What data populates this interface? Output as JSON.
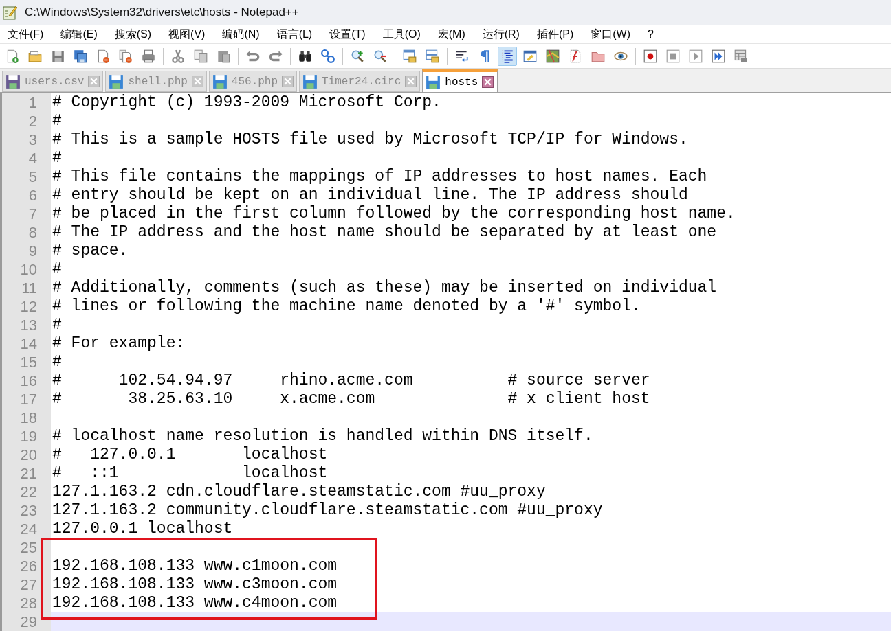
{
  "window": {
    "title": "C:\\Windows\\System32\\drivers\\etc\\hosts - Notepad++"
  },
  "menu": [
    {
      "label": "文件(F)"
    },
    {
      "label": "编辑(E)"
    },
    {
      "label": "搜索(S)"
    },
    {
      "label": "视图(V)"
    },
    {
      "label": "编码(N)"
    },
    {
      "label": "语言(L)"
    },
    {
      "label": "设置(T)"
    },
    {
      "label": "工具(O)"
    },
    {
      "label": "宏(M)"
    },
    {
      "label": "运行(R)"
    },
    {
      "label": "插件(P)"
    },
    {
      "label": "窗口(W)"
    },
    {
      "label": "?"
    }
  ],
  "toolbar": [
    {
      "kind": "new",
      "pressed": false
    },
    {
      "kind": "open",
      "pressed": false
    },
    {
      "kind": "save",
      "pressed": false
    },
    {
      "kind": "save-all",
      "pressed": false
    },
    {
      "kind": "close",
      "pressed": false
    },
    {
      "kind": "close-all",
      "pressed": false
    },
    {
      "kind": "print",
      "pressed": false
    },
    {
      "kind": "separator"
    },
    {
      "kind": "cut",
      "pressed": false
    },
    {
      "kind": "copy",
      "pressed": false
    },
    {
      "kind": "paste",
      "pressed": false
    },
    {
      "kind": "separator"
    },
    {
      "kind": "undo",
      "pressed": false
    },
    {
      "kind": "redo",
      "pressed": false
    },
    {
      "kind": "separator"
    },
    {
      "kind": "find",
      "pressed": false
    },
    {
      "kind": "replace",
      "pressed": false
    },
    {
      "kind": "separator"
    },
    {
      "kind": "zoom-in",
      "pressed": false
    },
    {
      "kind": "zoom-out",
      "pressed": false
    },
    {
      "kind": "separator"
    },
    {
      "kind": "sync-v",
      "pressed": false
    },
    {
      "kind": "sync-h",
      "pressed": false
    },
    {
      "kind": "separator"
    },
    {
      "kind": "wrap",
      "pressed": false
    },
    {
      "kind": "pilcrow",
      "pressed": false
    },
    {
      "kind": "indent-guide",
      "pressed": true
    },
    {
      "kind": "udl",
      "pressed": false
    },
    {
      "kind": "doc-map",
      "pressed": false
    },
    {
      "kind": "function-list",
      "pressed": false
    },
    {
      "kind": "folder",
      "pressed": false
    },
    {
      "kind": "monitor",
      "pressed": false
    },
    {
      "kind": "separator"
    },
    {
      "kind": "record",
      "pressed": false
    },
    {
      "kind": "stop",
      "pressed": false
    },
    {
      "kind": "play",
      "pressed": false
    },
    {
      "kind": "play-multi",
      "pressed": false
    },
    {
      "kind": "save-macro",
      "pressed": false
    }
  ],
  "tabs": [
    {
      "label": "users.csv",
      "selected": false
    },
    {
      "label": "shell.php",
      "selected": false
    },
    {
      "label": "456.php",
      "selected": false
    },
    {
      "label": "Timer24.circ",
      "selected": false
    },
    {
      "label": "hosts",
      "selected": true
    }
  ],
  "editor": {
    "lines": [
      {
        "number": "1",
        "text": "# Copyright (c) 1993-2009 Microsoft Corp.",
        "highlighted": false,
        "current": false
      },
      {
        "number": "2",
        "text": "#",
        "highlighted": false,
        "current": false
      },
      {
        "number": "3",
        "text": "# This is a sample HOSTS file used by Microsoft TCP/IP for Windows.",
        "highlighted": false,
        "current": false
      },
      {
        "number": "4",
        "text": "#",
        "highlighted": false,
        "current": false
      },
      {
        "number": "5",
        "text": "# This file contains the mappings of IP addresses to host names. Each",
        "highlighted": false,
        "current": false
      },
      {
        "number": "6",
        "text": "# entry should be kept on an individual line. The IP address should",
        "highlighted": false,
        "current": false
      },
      {
        "number": "7",
        "text": "# be placed in the first column followed by the corresponding host name.",
        "highlighted": false,
        "current": false
      },
      {
        "number": "8",
        "text": "# The IP address and the host name should be separated by at least one",
        "highlighted": false,
        "current": false
      },
      {
        "number": "9",
        "text": "# space.",
        "highlighted": false,
        "current": false
      },
      {
        "number": "10",
        "text": "#",
        "highlighted": false,
        "current": false
      },
      {
        "number": "11",
        "text": "# Additionally, comments (such as these) may be inserted on individual",
        "highlighted": false,
        "current": false
      },
      {
        "number": "12",
        "text": "# lines or following the machine name denoted by a '#' symbol.",
        "highlighted": false,
        "current": false
      },
      {
        "number": "13",
        "text": "#",
        "highlighted": false,
        "current": false
      },
      {
        "number": "14",
        "text": "# For example:",
        "highlighted": false,
        "current": false
      },
      {
        "number": "15",
        "text": "#",
        "highlighted": false,
        "current": false
      },
      {
        "number": "16",
        "text": "#      102.54.94.97     rhino.acme.com          # source server",
        "highlighted": false,
        "current": false
      },
      {
        "number": "17",
        "text": "#       38.25.63.10     x.acme.com              # x client host",
        "highlighted": false,
        "current": false
      },
      {
        "number": "18",
        "highlighted": false,
        "current": false
      },
      {
        "number": "19",
        "text": "# localhost name resolution is handled within DNS itself.",
        "highlighted": false,
        "current": false
      },
      {
        "number": "20",
        "text": "#   127.0.0.1       localhost",
        "highlighted": false,
        "current": false
      },
      {
        "number": "21",
        "text": "#   ::1             localhost",
        "highlighted": false,
        "current": false
      },
      {
        "number": "22",
        "text": "127.1.163.2 cdn.cloudflare.steamstatic.com #uu_proxy",
        "highlighted": false,
        "current": false
      },
      {
        "number": "23",
        "text": "127.1.163.2 community.cloudflare.steamstatic.com #uu_proxy",
        "highlighted": false,
        "current": false
      },
      {
        "number": "24",
        "text": "127.0.0.1 localhost",
        "highlighted": false,
        "current": false
      },
      {
        "number": "25",
        "highlighted": true,
        "current": false
      },
      {
        "number": "26",
        "text": "192.168.108.133 www.c1moon.com",
        "highlighted": true,
        "current": false
      },
      {
        "number": "27",
        "text": "192.168.108.133 www.c3moon.com",
        "highlighted": true,
        "current": false
      },
      {
        "number": "28",
        "text": "192.168.108.133 www.c4moon.com",
        "highlighted": true,
        "current": false
      },
      {
        "number": "29",
        "highlighted": false,
        "current": true
      }
    ]
  }
}
